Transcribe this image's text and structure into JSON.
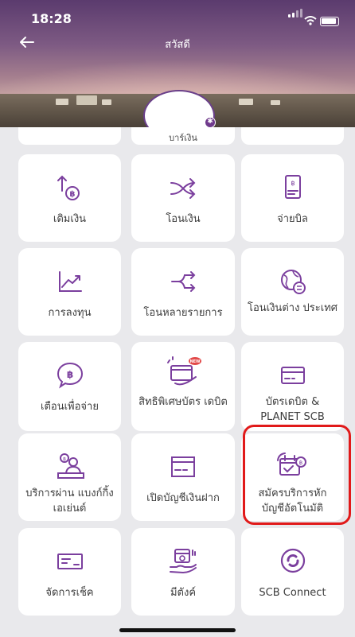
{
  "status_bar": {
    "time": "18:28"
  },
  "header": {
    "title": "สวัสดี"
  },
  "colors": {
    "accent": "#7b3f9e",
    "highlight": "#e11a1a"
  },
  "partial_row_label": "บาร์เงิน",
  "tiles": [
    {
      "label": "เติมเงิน",
      "icon": "top-up-baht-icon"
    },
    {
      "label": "โอนเงิน",
      "icon": "transfer-arrows-icon"
    },
    {
      "label": "จ่ายบิล",
      "icon": "bill-icon"
    },
    {
      "label": "การลงทุน",
      "icon": "investment-chart-icon"
    },
    {
      "label": "โอนหลายรายการ",
      "icon": "multi-transfer-icon"
    },
    {
      "label": "โอนเงินต่าง ประเทศ",
      "icon": "globe-transfer-icon"
    },
    {
      "label": "เตือนเพื่อจ่าย",
      "icon": "payment-reminder-icon"
    },
    {
      "label": "สิทธิพิเศษบัตร เดบิต",
      "icon": "debit-privilege-icon",
      "badge": "NEW"
    },
    {
      "label": "บัตรเดบิต & PLANET SCB",
      "icon": "debit-card-icon"
    },
    {
      "label": "บริการผ่าน แบงก์กิ้งเอเย่นต์",
      "icon": "banking-agent-icon"
    },
    {
      "label": "เปิดบัญชีเงินฝาก",
      "icon": "open-account-icon"
    },
    {
      "label": "สมัครบริการหัก บัญชีอัตโนมัติ",
      "icon": "auto-debit-icon"
    },
    {
      "label": "จัดการเช็ค",
      "icon": "cheque-icon"
    },
    {
      "label": "มีตังค์",
      "icon": "money-hand-icon"
    },
    {
      "label": "SCB Connect",
      "icon": "scb-connect-icon"
    }
  ]
}
